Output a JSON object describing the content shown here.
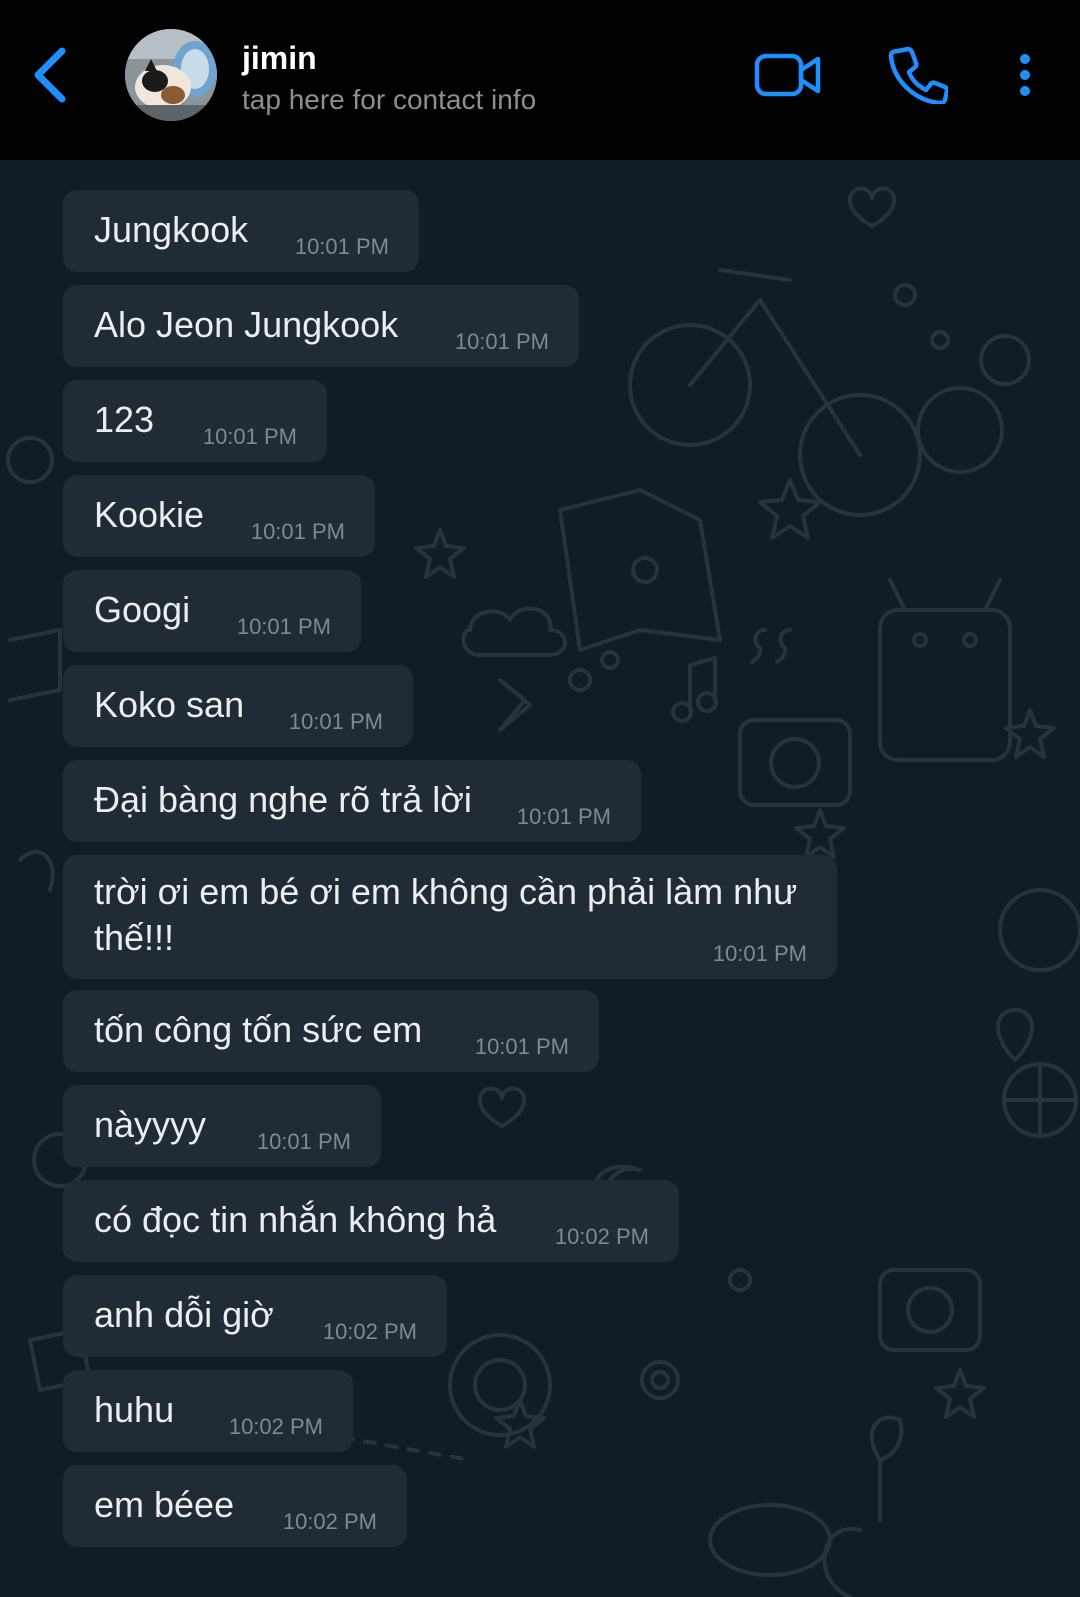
{
  "header": {
    "back_icon": "chevron-left-icon",
    "contact_name": "jimin",
    "contact_subtitle": "tap here for contact info",
    "video_icon": "video-camera-icon",
    "call_icon": "phone-icon",
    "more_icon": "more-vertical-icon",
    "accent_color": "#1e8fff"
  },
  "messages": [
    {
      "text": "Jungkook",
      "time": "10:01 PM"
    },
    {
      "text": "Alo Jeon Jungkook",
      "time": "10:01 PM"
    },
    {
      "text": "123",
      "time": "10:01 PM"
    },
    {
      "text": "Kookie",
      "time": "10:01 PM"
    },
    {
      "text": "Googi",
      "time": "10:01 PM"
    },
    {
      "text": "Koko san",
      "time": "10:01 PM"
    },
    {
      "text": "Đại bàng nghe rõ trả lời",
      "time": "10:01 PM"
    },
    {
      "text_line1": "trời ơi em bé ơi em không cần phải làm như",
      "text_line2": "thế!!!",
      "time": "10:01 PM"
    },
    {
      "text": "tốn công tốn sức em",
      "time": "10:01 PM"
    },
    {
      "text": "nàyyyy",
      "time": "10:01 PM"
    },
    {
      "text": "có đọc tin nhắn không hả",
      "time": "10:02 PM"
    },
    {
      "text": "anh dỗi giờ",
      "time": "10:02 PM"
    },
    {
      "text": "huhu",
      "time": "10:02 PM"
    },
    {
      "text": "em béee",
      "time": "10:02 PM"
    }
  ]
}
